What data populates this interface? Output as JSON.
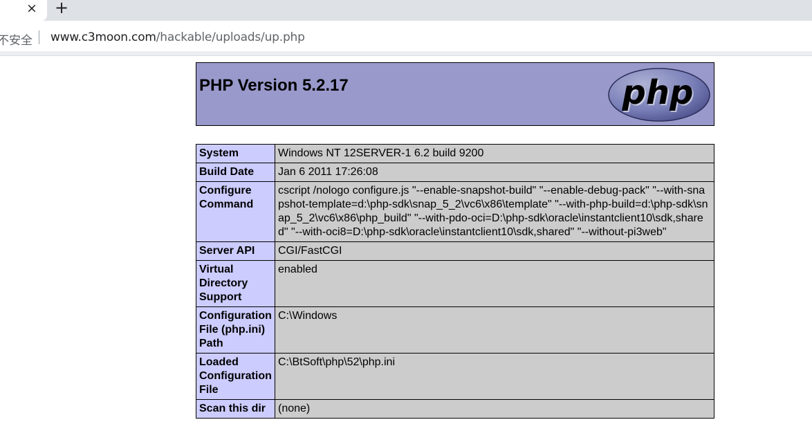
{
  "browser": {
    "tab_close": "×",
    "new_tab": "+",
    "security_label": "不安全",
    "url_host": "www.c3moon.com",
    "url_path": "/hackable/uploads/up.php"
  },
  "page": {
    "title": "PHP Version 5.2.17",
    "logo_text": "php",
    "rows": [
      {
        "label": "System",
        "value": "Windows NT 12SERVER-1 6.2 build 9200"
      },
      {
        "label": "Build Date",
        "value": "Jan 6 2011 17:26:08"
      },
      {
        "label": "Configure Command",
        "value": "cscript /nologo configure.js \"--enable-snapshot-build\" \"--enable-debug-pack\" \"--with-snapshot-template=d:\\php-sdk\\snap_5_2\\vc6\\x86\\template\" \"--with-php-build=d:\\php-sdk\\snap_5_2\\vc6\\x86\\php_build\" \"--with-pdo-oci=D:\\php-sdk\\oracle\\instantclient10\\sdk,shared\" \"--with-oci8=D:\\php-sdk\\oracle\\instantclient10\\sdk,shared\" \"--without-pi3web\""
      },
      {
        "label": "Server API",
        "value": "CGI/FastCGI"
      },
      {
        "label": "Virtual Directory Support",
        "value": "enabled"
      },
      {
        "label": "Configuration File (php.ini) Path",
        "value": "C:\\Windows"
      },
      {
        "label": "Loaded Configuration File",
        "value": "C:\\BtSoft\\php\\52\\php.ini"
      },
      {
        "label": "Scan this dir",
        "value": "(none)"
      }
    ]
  }
}
